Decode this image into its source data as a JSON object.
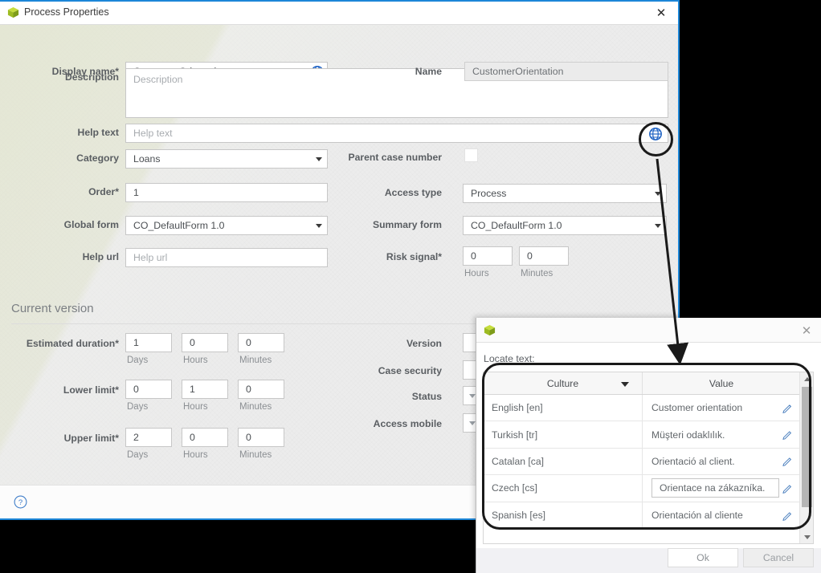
{
  "window": {
    "title": "Process Properties",
    "icon": "cube-icon",
    "close_label": "✕"
  },
  "accent_color": "#1c86d8",
  "brand_icon_color": "#b6cf2b",
  "form": {
    "left_fields": [
      {
        "label": "Display name*",
        "value": "Customer Orientation",
        "placeholder": "",
        "type": "text",
        "has_globe": true
      },
      {
        "label": "Description",
        "value": "",
        "placeholder": "Description",
        "type": "textarea",
        "has_globe": false
      },
      {
        "label": "Help text",
        "value": "",
        "placeholder": "Help text",
        "type": "text",
        "has_globe": true
      },
      {
        "label": "Category",
        "value": "Loans",
        "placeholder": "",
        "type": "dropdown",
        "has_globe": false
      },
      {
        "label": "Order*",
        "value": "1",
        "placeholder": "",
        "type": "text",
        "has_globe": false
      },
      {
        "label": "Global form",
        "value": "CO_DefaultForm 1.0",
        "placeholder": "",
        "type": "dropdown",
        "has_globe": false
      },
      {
        "label": "Help url",
        "value": "",
        "placeholder": "Help url",
        "type": "text",
        "has_globe": false
      }
    ],
    "right_fields": [
      {
        "label": "Name",
        "value": "CustomerOrientation",
        "type": "readonly"
      },
      {
        "label": "Parent case number",
        "value": "",
        "type": "checkbox",
        "checked": false
      },
      {
        "label": "Access type",
        "value": "Process",
        "type": "dropdown"
      },
      {
        "label": "Summary form",
        "value": "CO_DefaultForm 1.0",
        "type": "dropdown"
      },
      {
        "label": "Risk signal*",
        "value": "",
        "type": "duration"
      }
    ],
    "risk_signal": {
      "hours_value": "0",
      "minutes_value": "0",
      "hours_label": "Hours",
      "minutes_label": "Minutes"
    },
    "section": {
      "title": "Current version"
    },
    "durations": [
      {
        "label": "Estimated duration*",
        "days_value": "1",
        "hours_value": "0",
        "minutes_value": "0",
        "days_label": "Days",
        "hours_label": "Hours",
        "minutes_label": "Minutes"
      },
      {
        "label": "Lower limit*",
        "days_value": "0",
        "hours_value": "1",
        "minutes_value": "0",
        "days_label": "Days",
        "hours_label": "Hours",
        "minutes_label": "Minutes"
      },
      {
        "label": "Upper limit*",
        "days_value": "2",
        "hours_value": "0",
        "minutes_value": "0",
        "days_label": "Days",
        "hours_label": "Hours",
        "minutes_label": "Minutes"
      }
    ],
    "version_labels": [
      {
        "label": "Version"
      },
      {
        "label": "Case security"
      },
      {
        "label": "Status"
      },
      {
        "label": "Access mobile"
      }
    ],
    "footer": {
      "help_icon": "help-circle-icon"
    }
  },
  "popup": {
    "title": "",
    "icon": "cube-icon",
    "close_label": "✕",
    "locate_label": "Locate text:",
    "table": {
      "columns": [
        {
          "label": "Culture",
          "sort": "desc"
        },
        {
          "label": "Value",
          "sort": "none"
        }
      ],
      "rows": [
        {
          "culture": "English [en]",
          "value": "Customer orientation",
          "editing": false
        },
        {
          "culture": "Turkish [tr]",
          "value": "Müşteri odaklılık.",
          "editing": false
        },
        {
          "culture": "Catalan [ca]",
          "value": "Orientació al client.",
          "editing": false
        },
        {
          "culture": "Czech [cs]",
          "value": "Orientace na zákazníka.",
          "editing": true
        },
        {
          "culture": "Spanish [es]",
          "value": "Orientación al cliente",
          "editing": false
        }
      ]
    },
    "buttons": {
      "ok": "Ok",
      "cancel": "Cancel"
    }
  }
}
